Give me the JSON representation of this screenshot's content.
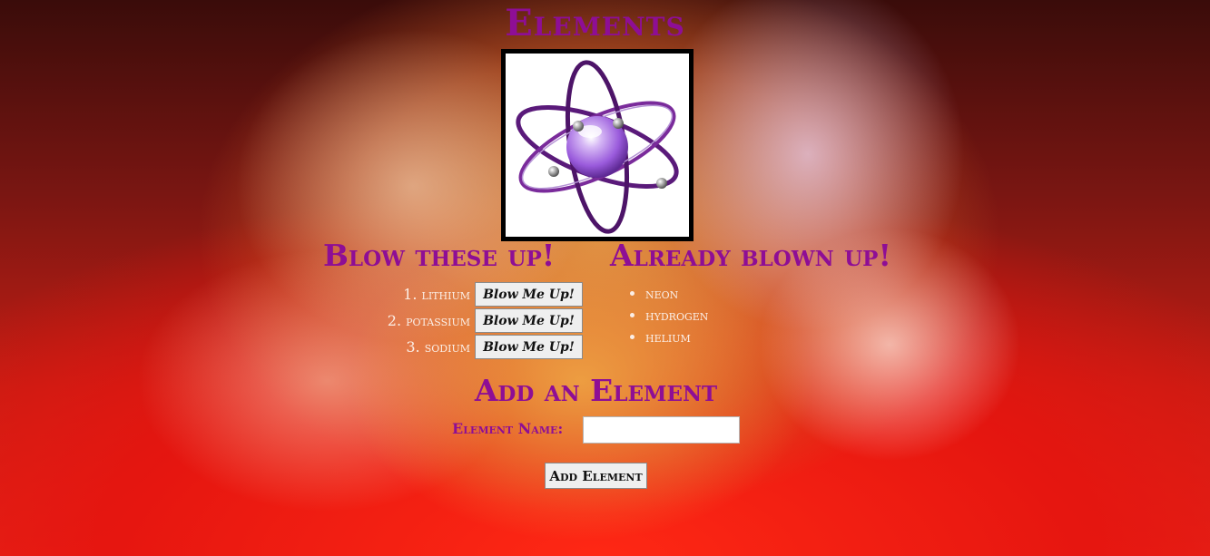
{
  "page": {
    "title": "Elements"
  },
  "logo": {
    "icon": "atom-icon"
  },
  "to_blow_up": {
    "heading": "Blow these up!",
    "button_label": "Blow Me Up!",
    "items": [
      {
        "number": "1.",
        "name": "lithium"
      },
      {
        "number": "2.",
        "name": "potassium"
      },
      {
        "number": "3.",
        "name": "sodium"
      }
    ]
  },
  "blown_up": {
    "heading": "Already blown up!",
    "items": [
      "neon",
      "hydrogen",
      "helium"
    ]
  },
  "add_form": {
    "heading": "Add an Element",
    "label": "Element Name:",
    "input_value": "",
    "input_placeholder": "",
    "submit_label": "Add Element"
  },
  "colors": {
    "heading": "#8e0e95",
    "list_text": "#fbeee6",
    "atom_purple": "#7a2b9b",
    "atom_nucleus": "#a77ae0"
  }
}
